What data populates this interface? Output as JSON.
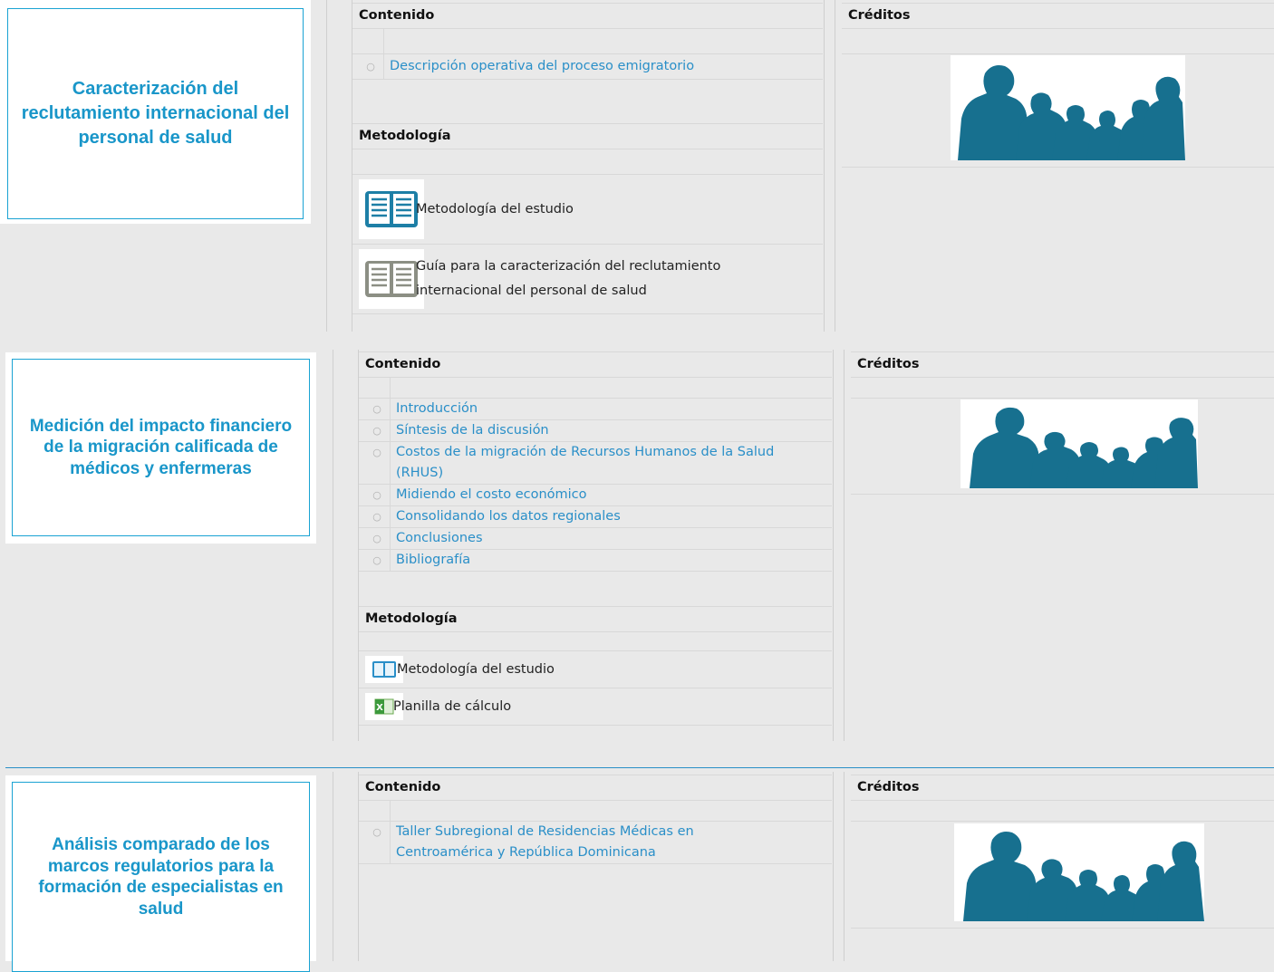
{
  "sections": [
    {
      "title": "Caracterización del reclutamiento internacional del personal de salud",
      "contenido_label": "Contenido",
      "creditos_label": "Créditos",
      "contenido_items": [
        "Descripción operativa del proceso emigratorio"
      ],
      "metodologia_label": "Metodología",
      "documents": [
        {
          "label": "Metodología del estudio",
          "icon": "book-blue-icon"
        },
        {
          "label": "Guía para la caracterización del reclutamiento internacional del personal de salud",
          "icon": "book-gray-icon"
        }
      ]
    },
    {
      "title": "Medición del impacto financiero de la migración calificada de médicos y enfermeras",
      "contenido_label": "Contenido",
      "creditos_label": "Créditos",
      "contenido_items": [
        "Introducción",
        "Síntesis de la discusión",
        "Costos de la migración de Recursos Humanos de la Salud (RHUS)",
        "Midiendo el costo económico",
        "Consolidando los datos regionales",
        "Conclusiones",
        "Bibliografía"
      ],
      "metodologia_label": "Metodología",
      "documents": [
        {
          "label": "Metodología del estudio",
          "icon": "book-icon"
        },
        {
          "label": "Planilla de cálculo",
          "icon": "spreadsheet-icon"
        }
      ]
    },
    {
      "title": "Análisis comparado de los marcos regulatorios para la formación de especialistas en salud",
      "contenido_label": "Contenido",
      "creditos_label": "Créditos",
      "contenido_items": [
        "Taller Subregional de Residencias Médicas en Centroamérica y República Dominicana"
      ]
    }
  ],
  "colors": {
    "accent": "#1996c9",
    "link": "#2a8fc8",
    "silhouette": "#17708f",
    "background": "#e9e9e9"
  }
}
